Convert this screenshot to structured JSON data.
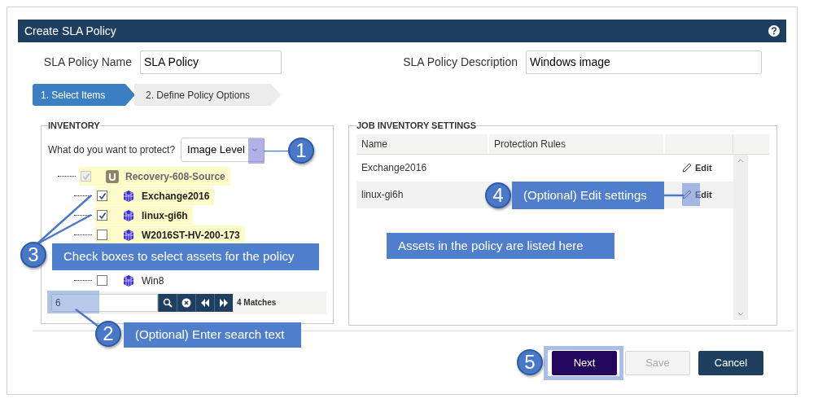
{
  "dialog": {
    "title": "Create SLA Policy"
  },
  "fields": [
    {
      "label": "SLA Policy Name",
      "value": "SLA Policy"
    },
    {
      "label": "SLA Policy Description",
      "value": "Windows image"
    }
  ],
  "steps": [
    {
      "label": "1. Select Items",
      "selected": true
    },
    {
      "label": "2. Define Policy Options",
      "selected": false
    }
  ],
  "inventory": {
    "title": "INVENTORY",
    "protect_label": "What do you want to protect?",
    "protect_value": "Image Level",
    "tree": [
      {
        "label": "Recovery-608-Source",
        "kind": "group",
        "checked": true,
        "disabled": true,
        "match": true,
        "children": [
          {
            "label": "Exchange2016",
            "kind": "vm",
            "checked": true,
            "match": true
          },
          {
            "label": "linux-gi6h",
            "kind": "vm",
            "checked": true,
            "match": true
          },
          {
            "label": "W2016ST-HV-200-173",
            "kind": "vm",
            "checked": false,
            "match": true
          },
          {
            "label": "Win8",
            "kind": "vm",
            "checked": false,
            "match": false
          }
        ]
      }
    ],
    "search": {
      "value": "6",
      "matches": "4 Matches"
    }
  },
  "job_inventory": {
    "title": "JOB INVENTORY SETTINGS",
    "columns": [
      "Name",
      "Protection Rules"
    ],
    "rows": [
      {
        "name": "Exchange2016",
        "action": "Edit"
      },
      {
        "name": "linux-gi6h",
        "action": "Edit"
      }
    ]
  },
  "buttons": [
    {
      "label": "Next",
      "kind": "primary",
      "disabled": false
    },
    {
      "label": "Save",
      "kind": "secondary",
      "disabled": true
    },
    {
      "label": "Cancel",
      "kind": "dark",
      "disabled": false
    }
  ],
  "callouts": [
    {
      "number": "1"
    },
    {
      "number": "4",
      "text": "(Optional) Edit settings"
    },
    {
      "number": "3",
      "text": "Check boxes to select assets for the policy"
    },
    {
      "number": "2",
      "text": "(Optional) Enter search text"
    },
    {
      "number": "5"
    }
  ],
  "note": {
    "text": "Assets in the policy are listed here"
  }
}
